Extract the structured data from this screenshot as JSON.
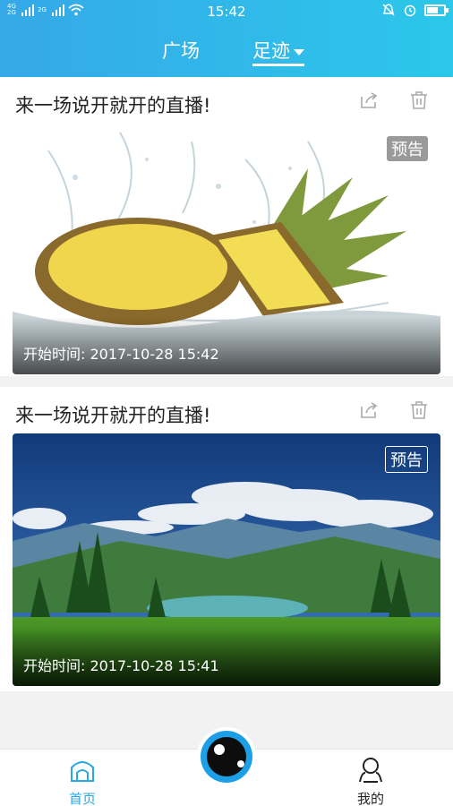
{
  "statusbar": {
    "time": "15:42",
    "network_top": "4G",
    "network_bottom": "2G",
    "network_small": "2G"
  },
  "tabs": [
    {
      "label": "广场",
      "active": false
    },
    {
      "label": "足迹",
      "active": true
    }
  ],
  "cards": [
    {
      "title": "来一场说开就开的直播!",
      "badge": "预告",
      "time_label": "开始时间: 2017-10-28 15:42",
      "image": "pineapple-splash"
    },
    {
      "title": "来一场说开就开的直播!",
      "badge": "预告",
      "time_label": "开始时间: 2017-10-28 15:41",
      "image": "mountain-landscape"
    }
  ],
  "nav": {
    "home_label": "首页",
    "mine_label": "我的"
  },
  "colors": {
    "header_start": "#35a8e8",
    "header_end": "#2cc7ea",
    "active_nav": "#28a8e8",
    "eye_ring": "#1c9fe6"
  }
}
